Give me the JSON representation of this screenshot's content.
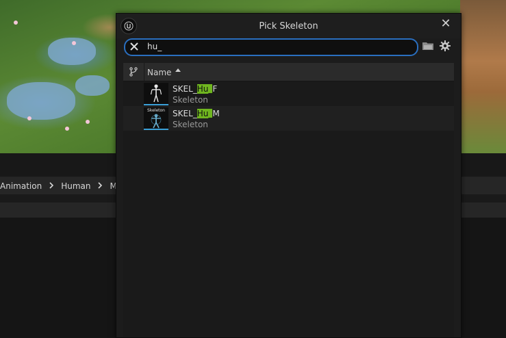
{
  "dialog": {
    "title": "Pick Skeleton",
    "close_label": "✕"
  },
  "search": {
    "value": "hu_"
  },
  "list": {
    "column_header": "Name",
    "items": [
      {
        "name_prefix": "SKEL_",
        "name_match": "Hu_",
        "name_suffix": "F",
        "type": "Skeleton",
        "thumb_caption": ""
      },
      {
        "name_prefix": "SKEL_",
        "name_match": "Hu_",
        "name_suffix": "M",
        "type": "Skeleton",
        "thumb_caption": "Skeleton"
      }
    ]
  },
  "breadcrumb": {
    "items": [
      "Animation",
      "Human",
      "M"
    ]
  },
  "colors": {
    "accent": "#2a6fc0",
    "highlight": "#6fb51f",
    "thumb_underline": "#3aa0d8"
  }
}
